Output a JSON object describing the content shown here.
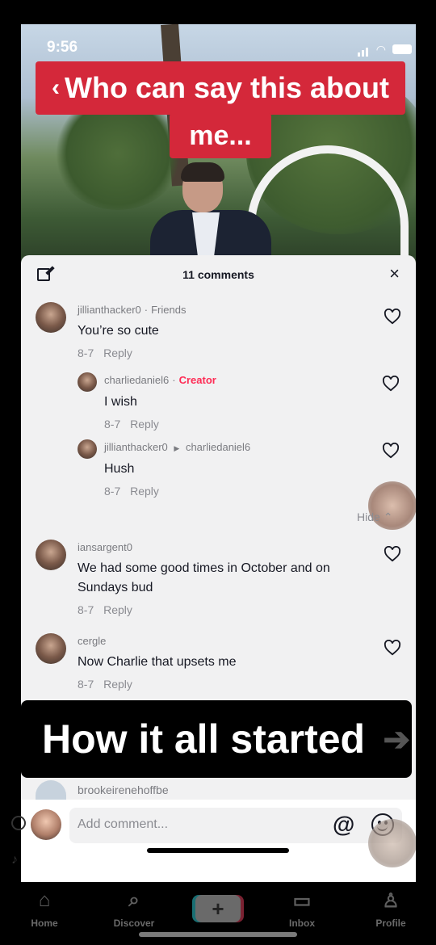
{
  "status": {
    "time": "9:56"
  },
  "video": {
    "caption_line1": "Who can say this about",
    "caption_line2": "me..."
  },
  "comments_sheet": {
    "title": "11 comments",
    "close_label": "×",
    "hide_label": "Hide",
    "comments": [
      {
        "user": "jillianthacker0",
        "tag": "Friends",
        "text": "You’re so cute",
        "date": "8-7",
        "reply": "Reply"
      },
      {
        "user": "charliedaniel6",
        "tag": "Creator",
        "text": "I wish",
        "date": "8-7",
        "reply": "Reply"
      },
      {
        "user": "jillianthacker0",
        "reply_to": "charliedaniel6",
        "text": "Hush",
        "date": "8-7",
        "reply": "Reply"
      },
      {
        "user": "iansargent0",
        "text": "We had some good times in October and on Sundays bud",
        "date": "8-7",
        "reply": "Reply"
      },
      {
        "user": "cergle",
        "text": "Now Charlie that upsets me",
        "date": "8-7",
        "reply": "Reply"
      },
      {
        "user": "brookeirenehoffbe"
      }
    ],
    "banner_text": "How it all started",
    "input_placeholder": "Add comment..."
  },
  "nav": {
    "home": "Home",
    "discover": "Discover",
    "inbox": "Inbox",
    "profile": "Profile",
    "add": "+"
  },
  "colors": {
    "caption_red": "#d4283a",
    "creator_pink": "#fe2c55",
    "sheet_bg": "#f1f1f2"
  }
}
